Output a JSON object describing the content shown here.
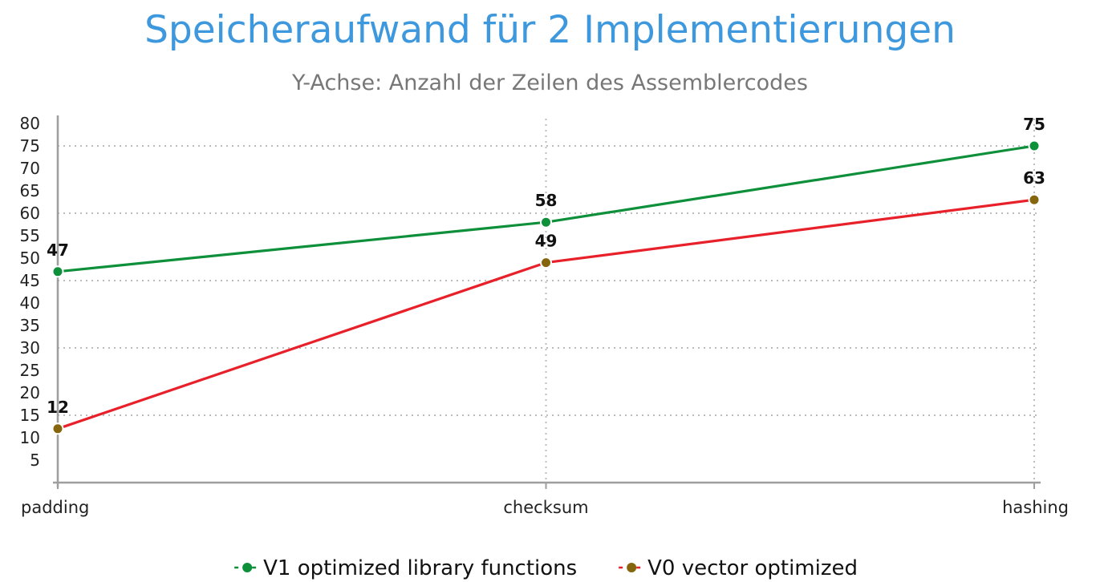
{
  "chart_data": {
    "type": "line",
    "title": "Speicheraufwand für 2 Implementierungen",
    "subtitle": "Y-Achse: Anzahl der Zeilen des Assemblercodes",
    "xlabel": "",
    "ylabel": "",
    "categories": [
      "padding",
      "checksum",
      "hashing"
    ],
    "ylim": [
      0,
      80
    ],
    "yticks": [
      5,
      10,
      15,
      20,
      25,
      30,
      35,
      40,
      45,
      50,
      55,
      60,
      65,
      70,
      75,
      80
    ],
    "y_gridlines": [
      15,
      30,
      45,
      60,
      75
    ],
    "grid": "dotted",
    "legend_position": "bottom",
    "series": [
      {
        "name": "V1 optimized library functions",
        "values": [
          47,
          58,
          75
        ],
        "line_color": "#0e8f3a",
        "marker_color": "#0e8f3a"
      },
      {
        "name": "V0 vector optimized",
        "values": [
          12,
          49,
          63
        ],
        "line_color": "#e8202a",
        "marker_color": "#85660d"
      }
    ]
  }
}
